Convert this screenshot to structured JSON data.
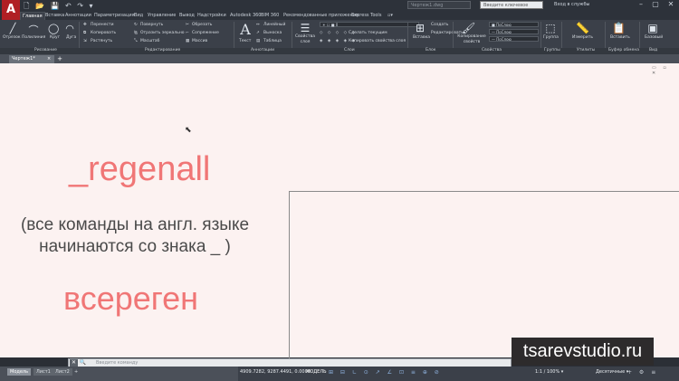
{
  "window": {
    "app_logo": "A",
    "doc_title": "Чертеж1.dwg",
    "search_placeholder": "Введите ключевое слово/фразу",
    "login_label": "Вход в службы",
    "controls": [
      "–",
      "▢",
      "✕"
    ]
  },
  "quick_access": "🗋 📂 💾 ↶ ↷ ▾",
  "menu": {
    "tabs": [
      "Главная",
      "Вставка",
      "Аннотации",
      "Параметризация",
      "Вид",
      "Управление",
      "Вывод",
      "Надстройки",
      "Autodesk 360",
      "BIM 360",
      "Рекомендованные приложения",
      "Express Tools",
      "▫▾"
    ]
  },
  "ribbon": {
    "draw": {
      "title": "Рисование",
      "tools": [
        "Отрезок",
        "Полилиния",
        "Круг",
        "Дуга"
      ]
    },
    "modify": {
      "title": "Редактирование",
      "tools": [
        "Перенести",
        "Повернуть",
        "Обрезать",
        "Копировать",
        "Отразить зеркально",
        "Сопряжение",
        "Растянуть",
        "Масштаб",
        "Массив"
      ]
    },
    "annotation": {
      "title": "Аннотации",
      "text": "Текст",
      "tools": [
        "Линейный",
        "Выноска",
        "Таблица"
      ]
    },
    "layers": {
      "title": "Слои",
      "props": "Свойства слоя",
      "tools": [
        "Сделать текущим",
        "Копировать свойства слоя"
      ],
      "current": "0"
    },
    "block": {
      "title": "Блок",
      "insert": "Вставка",
      "create": "Создать",
      "edit": "Редактировать"
    },
    "properties": {
      "title": "Свойства",
      "match": "Копирование свойств",
      "combos": [
        "ПоСлою",
        "ПоСлою",
        "ПоСлою"
      ]
    },
    "groups": {
      "title": "Группы",
      "label": "Группа"
    },
    "utilities": {
      "title": "Утилиты",
      "label": "Измерить"
    },
    "clipboard": {
      "title": "Буфер обмена",
      "label": "Вставить"
    },
    "view": {
      "title": "Вид",
      "label": "Базовый"
    }
  },
  "file_tabs": {
    "active": "Чертеж1*",
    "close": "×",
    "new": "+"
  },
  "viewport_controls": "▭ ▫ ✕",
  "canvas": {
    "command": "_regenall",
    "note_line1": "(все команды на англ. языке",
    "note_line2": "начинаются со знака _ )",
    "russian_command": "всереген",
    "cursor": "⬉"
  },
  "watermark": "tsarevstudio.ru",
  "command_line": {
    "placeholder": "Введите команду",
    "close": "✕",
    "search": "🔍"
  },
  "layout_tabs": [
    "Модель",
    "Лист1",
    "Лист2",
    "+"
  ],
  "status": {
    "coords": "4909.7282, 9287.4491, 0.0000",
    "model": "МОДЕЛЬ",
    "icons": "⊞ ⊟ ∟ ⊙ ↗ ∠ ⊡ ≡ ⊕ ⊘",
    "scale": "1:1 / 100% ▾",
    "units": "Десятичные ▾",
    "icons2": "+ ⚙ ≡"
  }
}
